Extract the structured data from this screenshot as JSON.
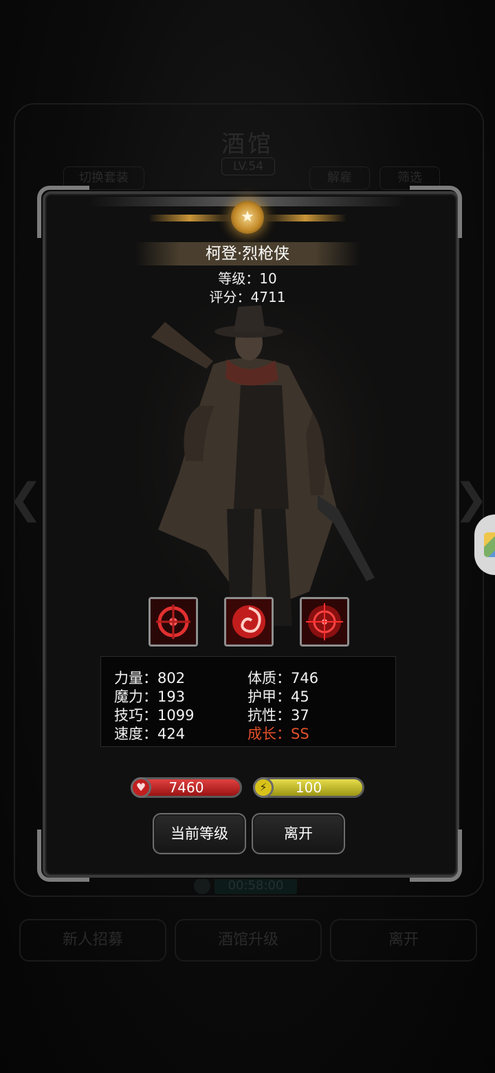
{
  "background": {
    "title": "酒馆",
    "level": "LV.54",
    "switch_outfit": "切换套装",
    "dismiss": "解雇",
    "filter": "筛选",
    "timer": "00:58:00",
    "buttons": [
      "新人招募",
      "酒馆升级",
      "离开"
    ]
  },
  "hero": {
    "name": "柯登·烈枪侠",
    "level_line": "等级：10",
    "score_line": "评分：4711"
  },
  "skills": [
    "crosshair-skill-icon",
    "vortex-skill-icon",
    "target-skill-icon"
  ],
  "stats": {
    "strength": "力量：802",
    "magic": "魔力：193",
    "skill": "技巧：1099",
    "speed": "速度：424",
    "constitution": "体质：746",
    "armor": "护甲：45",
    "resistance": "抗性：37",
    "growth": "成长：SS"
  },
  "bars": {
    "hp": "7460",
    "energy": "100"
  },
  "buttons": {
    "current_level": "当前等级",
    "leave": "离开"
  },
  "colors": {
    "growth": "#e1502a",
    "hp": "#c21f1f",
    "energy": "#d8c21a"
  }
}
